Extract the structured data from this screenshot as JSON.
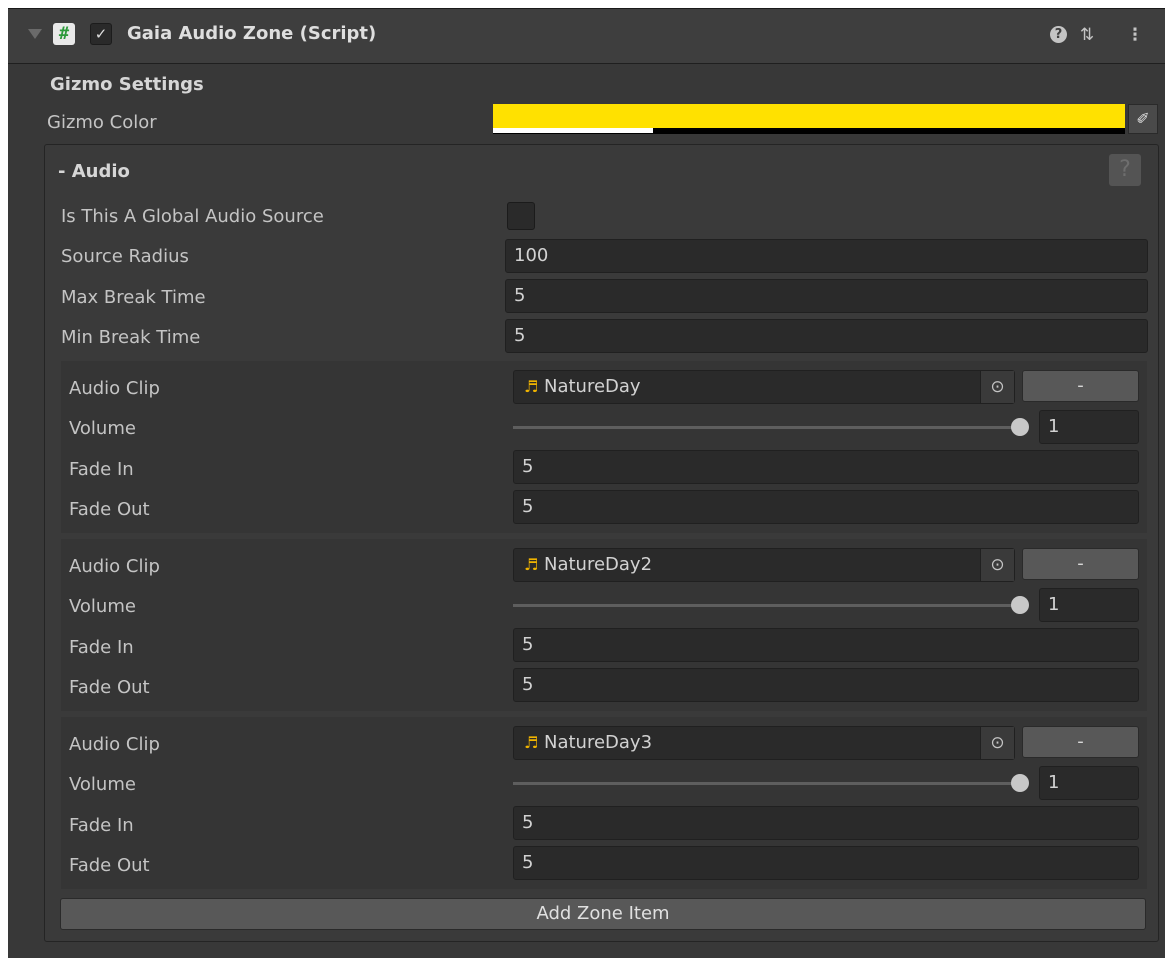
{
  "component": {
    "title": "Gaia Audio Zone (Script)",
    "script_icon": "#",
    "enabled_mark": "✓",
    "help_glyph": "?",
    "presets_glyph": "⇅",
    "menu_glyph": "⋮"
  },
  "gizmo": {
    "section_title": "Gizmo Settings",
    "color_label": "Gizmo Color",
    "color_value": "#ffe100",
    "eyedropper_glyph": "✐"
  },
  "audio": {
    "title": "- Audio",
    "help_glyph": "?",
    "global_label": "Is This A Global Audio Source",
    "global_checked": false,
    "radius_label": "Source Radius",
    "radius_value": "100",
    "max_break_label": "Max Break Time",
    "max_break_value": "5",
    "min_break_label": "Min Break Time",
    "min_break_value": "5"
  },
  "zone_items": [
    {
      "clip_label": "Audio Clip",
      "clip_name": "NatureDay",
      "clip_icon": "♬",
      "picker_glyph": "⊙",
      "remove_label": "-",
      "volume_label": "Volume",
      "volume_value": "1",
      "volume_fraction": 1.0,
      "fade_in_label": "Fade In",
      "fade_in_value": "5",
      "fade_out_label": "Fade Out",
      "fade_out_value": "5"
    },
    {
      "clip_label": "Audio Clip",
      "clip_name": "NatureDay2",
      "clip_icon": "♬",
      "picker_glyph": "⊙",
      "remove_label": "-",
      "volume_label": "Volume",
      "volume_value": "1",
      "volume_fraction": 1.0,
      "fade_in_label": "Fade In",
      "fade_in_value": "5",
      "fade_out_label": "Fade Out",
      "fade_out_value": "5"
    },
    {
      "clip_label": "Audio Clip",
      "clip_name": "NatureDay3",
      "clip_icon": "♬",
      "picker_glyph": "⊙",
      "remove_label": "-",
      "volume_label": "Volume",
      "volume_value": "1",
      "volume_fraction": 1.0,
      "fade_in_label": "Fade In",
      "fade_in_value": "5",
      "fade_out_label": "Fade Out",
      "fade_out_value": "5"
    }
  ],
  "add_button_label": "Add Zone Item"
}
